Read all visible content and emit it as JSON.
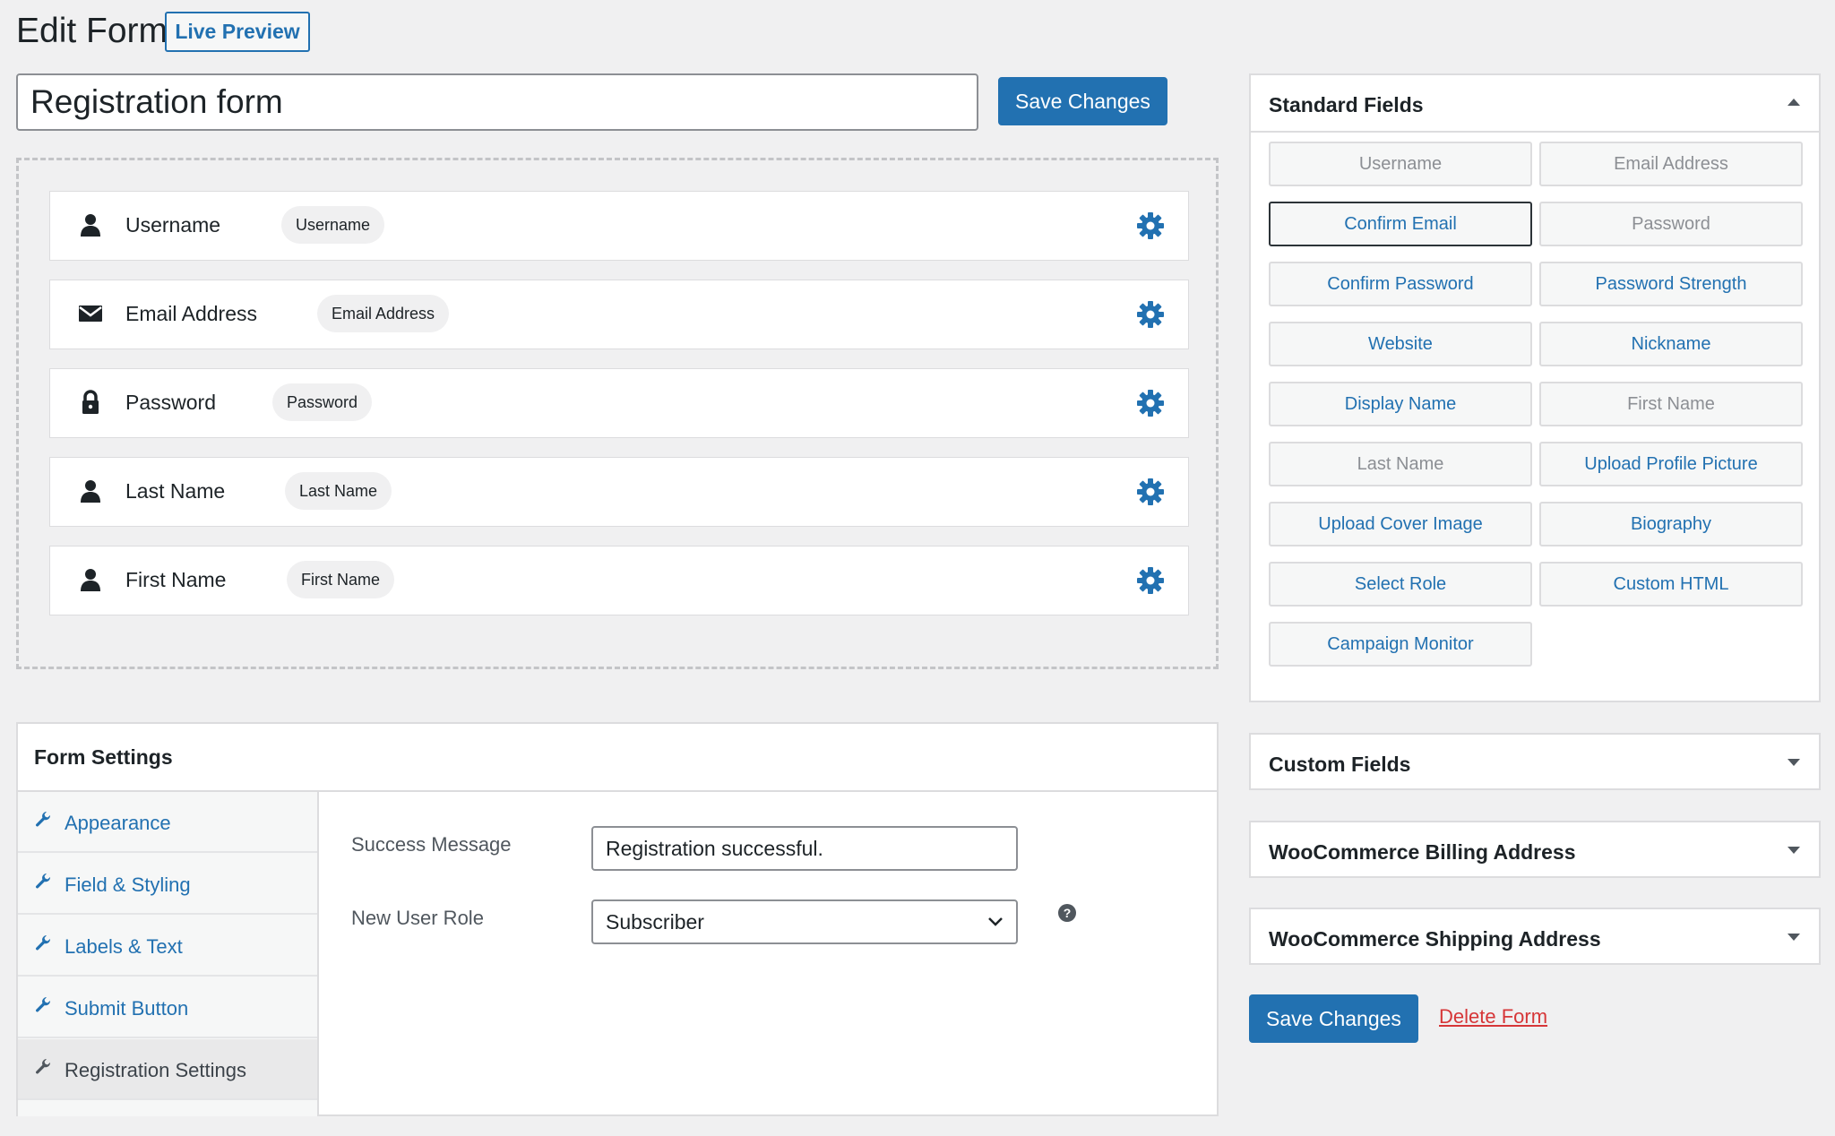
{
  "header": {
    "title": "Edit Form",
    "live_preview_label": "Live Preview"
  },
  "form_name": "Registration form",
  "save_label": "Save Changes",
  "fields": [
    {
      "label": "Username",
      "badge": "Username",
      "icon": "user-icon"
    },
    {
      "label": "Email Address",
      "badge": "Email Address",
      "icon": "envelope-icon"
    },
    {
      "label": "Password",
      "badge": "Password",
      "icon": "lock-icon"
    },
    {
      "label": "Last Name",
      "badge": "Last Name",
      "icon": "user-icon"
    },
    {
      "label": "First Name",
      "badge": "First Name",
      "icon": "user-icon"
    }
  ],
  "settings": {
    "title": "Form Settings",
    "nav": [
      {
        "label": "Appearance"
      },
      {
        "label": "Field & Styling"
      },
      {
        "label": "Labels & Text"
      },
      {
        "label": "Submit Button"
      },
      {
        "label": "Registration Settings",
        "active": true
      }
    ],
    "success_label": "Success Message",
    "success_value": "Registration successful.",
    "role_label": "New User Role",
    "role_value": "Subscriber"
  },
  "standard_fields": {
    "title": "Standard Fields",
    "buttons": [
      {
        "label": "Username",
        "state": "disabled"
      },
      {
        "label": "Email Address",
        "state": "disabled"
      },
      {
        "label": "Confirm Email",
        "state": "selected"
      },
      {
        "label": "Password",
        "state": "disabled"
      },
      {
        "label": "Confirm Password",
        "state": "enabled"
      },
      {
        "label": "Password Strength",
        "state": "enabled"
      },
      {
        "label": "Website",
        "state": "enabled"
      },
      {
        "label": "Nickname",
        "state": "enabled"
      },
      {
        "label": "Display Name",
        "state": "enabled"
      },
      {
        "label": "First Name",
        "state": "disabled"
      },
      {
        "label": "Last Name",
        "state": "disabled"
      },
      {
        "label": "Upload Profile Picture",
        "state": "enabled"
      },
      {
        "label": "Upload Cover Image",
        "state": "enabled"
      },
      {
        "label": "Biography",
        "state": "enabled"
      },
      {
        "label": "Select Role",
        "state": "enabled"
      },
      {
        "label": "Custom HTML",
        "state": "enabled"
      },
      {
        "label": "Campaign Monitor",
        "state": "enabled"
      }
    ]
  },
  "panels": {
    "custom_fields": "Custom Fields",
    "woo_billing": "WooCommerce Billing Address",
    "woo_shipping": "WooCommerce Shipping Address"
  },
  "delete_label": "Delete Form",
  "colors": {
    "accent": "#2271b1",
    "danger": "#d63638",
    "background": "#f0f0f1"
  }
}
